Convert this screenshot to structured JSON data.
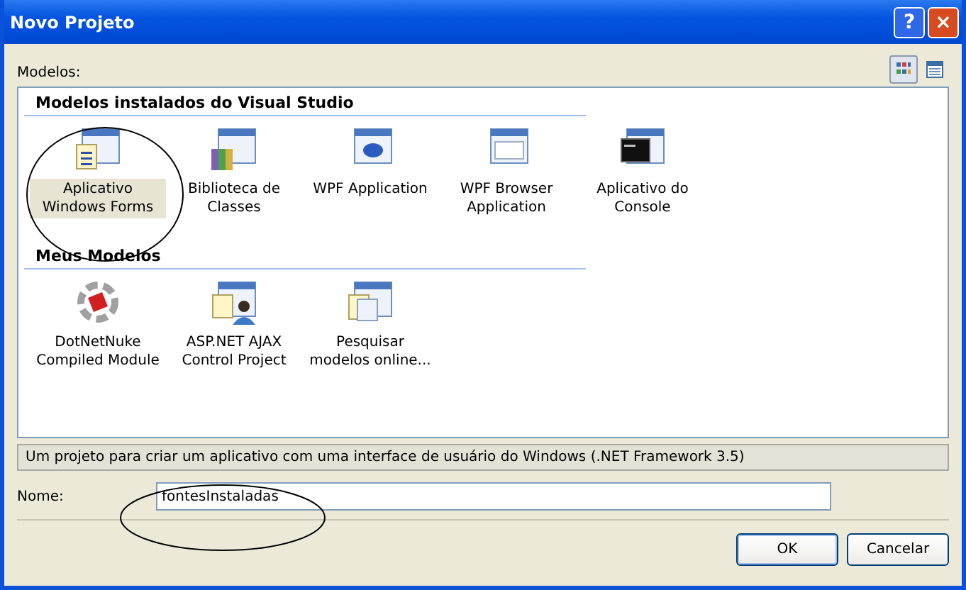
{
  "window": {
    "title": "Novo Projeto",
    "help_button": "?",
    "close_button": "×"
  },
  "templates_label": "Modelos:",
  "view_buttons": [
    {
      "kind": "large",
      "selected": true
    },
    {
      "kind": "small",
      "selected": false
    }
  ],
  "groups": [
    {
      "title": "Modelos instalados do Visual Studio",
      "items": [
        {
          "label": "Aplicativo Windows Forms",
          "kind": "form",
          "selected": true
        },
        {
          "label": "Biblioteca de Classes",
          "kind": "library",
          "selected": false
        },
        {
          "label": "WPF Application",
          "kind": "wpf",
          "selected": false
        },
        {
          "label": "WPF Browser Application",
          "kind": "browser",
          "selected": false
        },
        {
          "label": "Aplicativo do Console",
          "kind": "console",
          "selected": false
        }
      ]
    },
    {
      "title": "Meus Modelos",
      "items": [
        {
          "label": "DotNetNuke Compiled Module",
          "kind": "module",
          "selected": false
        },
        {
          "label": "ASP.NET AJAX Control Project",
          "kind": "web",
          "selected": false
        },
        {
          "label": "Pesquisar modelos online...",
          "kind": "search",
          "selected": false
        }
      ]
    }
  ],
  "description": "Um projeto para criar um aplicativo com uma interface de usuário do Windows (.NET Framework 3.5)",
  "name_field": {
    "label": "Nome:",
    "value": "fontesInstaladas"
  },
  "buttons": [
    {
      "label": "OK",
      "kind": "default"
    },
    {
      "label": "Cancelar",
      "kind": "normal"
    }
  ]
}
